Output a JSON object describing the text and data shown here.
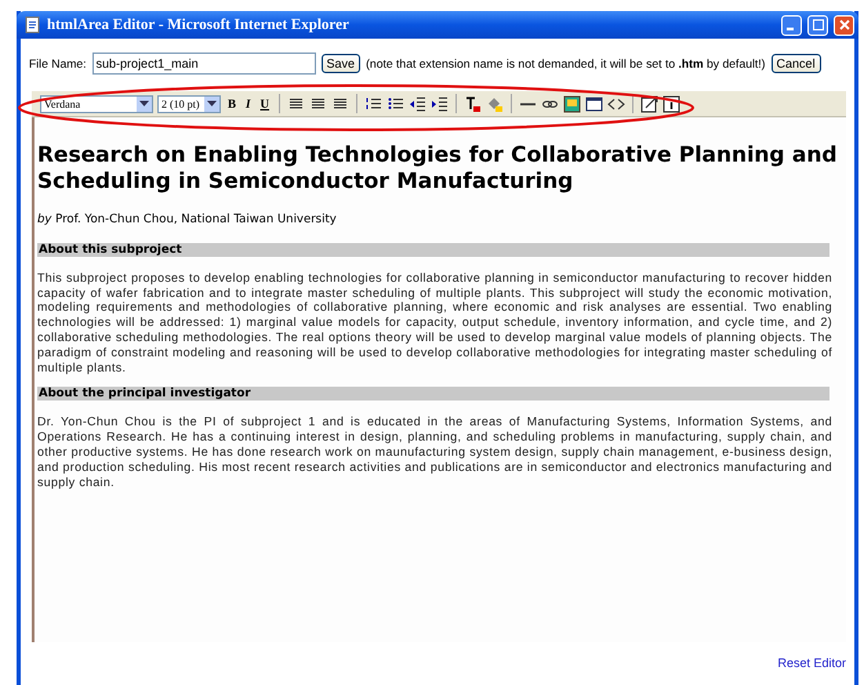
{
  "window": {
    "title": "htmlArea Editor - Microsoft Internet Explorer"
  },
  "file_bar": {
    "label": "File Name:",
    "value": "sub-project1_main",
    "save": "Save",
    "note": "(note that extension name is not demanded, it will be set to **.htm** by default!)",
    "cancel": "Cancel"
  },
  "toolbar": {
    "font": "Verdana",
    "size": "2 (10 pt)",
    "format_buttons": [
      "B",
      "I",
      "U"
    ]
  },
  "document": {
    "title": "Research on Enabling Technologies for Collaborative Planning and Scheduling in Semiconductor Manufacturing",
    "byline": "*by* Prof. Yon-Chun Chou, National Taiwan University",
    "sections": [
      {
        "heading": "About this subproject",
        "text": "This subproject proposes to develop enabling technologies for collaborative planning in semiconductor manufacturing to recover hidden capacity of wafer fabrication and to integrate master scheduling of multiple plants. This subproject will study the economic motivation, modeling requirements and methodologies of collaborative planning, where economic and risk analyses are essential. Two enabling technologies will be addressed: 1) marginal value models for capacity, output schedule, inventory information, and cycle time, and 2) collaborative scheduling methodologies. The real options theory will be used to develop marginal value models of planning objects. The paradigm of constraint modeling and reasoning will be used to develop collaborative methodologies for integrating master scheduling of multiple plants."
      },
      {
        "heading": "About the principal investigator",
        "text": "Dr. Yon-Chun Chou is the PI of subproject 1 and is educated in the areas of Manufacturing Systems, Information Systems, and Operations Research. He has a continuing interest in design, planning, and scheduling problems in manufacturing, supply chain, and other productive systems. He has done research work on maunufacturing system design, supply chain management, e-business design, and production scheduling. His most recent research activities and publications are in semiconductor and electronics manufacturing and supply chain."
      }
    ]
  },
  "reset_link": "Reset Editor"
}
